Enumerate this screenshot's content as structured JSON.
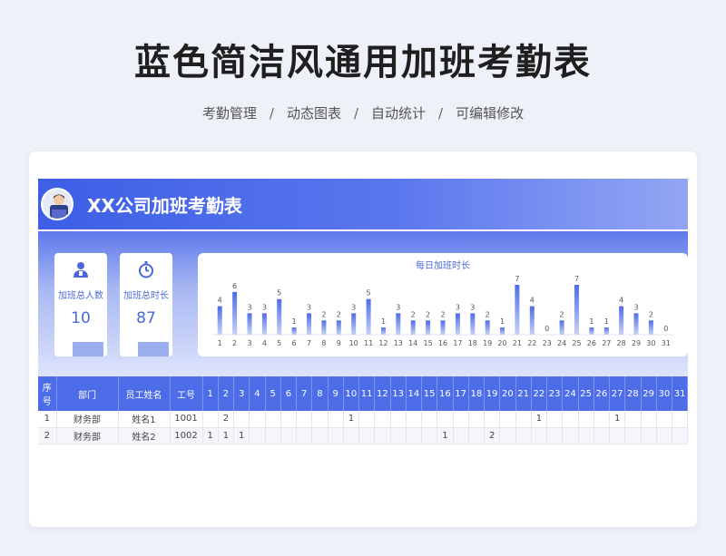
{
  "header": {
    "title": "蓝色简洁风通用加班考勤表",
    "tags": [
      "考勤管理",
      "动态图表",
      "自动统计",
      "可编辑修改"
    ],
    "separators": [
      "/",
      "/",
      "/"
    ]
  },
  "sheet": {
    "banner_title": "XX公司加班考勤表",
    "stats": [
      {
        "label": "加班总人数",
        "value": "10",
        "icon": "employee-icon"
      },
      {
        "label": "加班总时长",
        "value": "87",
        "icon": "stopwatch-icon"
      }
    ],
    "table": {
      "fixed_headers": [
        "序号",
        "部门",
        "员工姓名",
        "工号"
      ],
      "day_headers": [
        "1",
        "2",
        "3",
        "4",
        "5",
        "6",
        "7",
        "8",
        "9",
        "10",
        "11",
        "12",
        "13",
        "14",
        "15",
        "16",
        "17",
        "18",
        "19",
        "20",
        "21",
        "22",
        "23",
        "24",
        "25",
        "26",
        "27",
        "28",
        "29",
        "30",
        "31"
      ],
      "rows": [
        {
          "no": "1",
          "dept": "财务部",
          "name": "姓名1",
          "id": "1001",
          "days": [
            "",
            "2",
            "",
            "",
            "",
            "",
            "",
            "",
            "",
            "1",
            "",
            "",
            "",
            "",
            "",
            "",
            "",
            "",
            "",
            "",
            "",
            "1",
            "",
            "",
            "",
            "",
            "1",
            "",
            "",
            "",
            ""
          ]
        },
        {
          "no": "2",
          "dept": "财务部",
          "name": "姓名2",
          "id": "1002",
          "days": [
            "1",
            "1",
            "1",
            "",
            "",
            "",
            "",
            "",
            "",
            "",
            "",
            "",
            "",
            "",
            "",
            "1",
            "",
            "",
            "2",
            "",
            "",
            "",
            "",
            "",
            "",
            "",
            "",
            "",
            "",
            "",
            ""
          ]
        }
      ]
    }
  },
  "chart_data": {
    "type": "bar",
    "title": "每日加班时长",
    "categories": [
      "1",
      "2",
      "3",
      "4",
      "5",
      "6",
      "7",
      "8",
      "9",
      "10",
      "11",
      "12",
      "13",
      "14",
      "15",
      "16",
      "17",
      "18",
      "19",
      "20",
      "21",
      "22",
      "23",
      "24",
      "25",
      "26",
      "27",
      "28",
      "29",
      "30",
      "31"
    ],
    "values": [
      4,
      6,
      3,
      3,
      5,
      1,
      3,
      2,
      2,
      3,
      5,
      1,
      3,
      2,
      2,
      2,
      3,
      3,
      2,
      1,
      7,
      4,
      0,
      2,
      7,
      1,
      1,
      4,
      3,
      2,
      0
    ],
    "ylim": [
      0,
      7
    ],
    "grid": false,
    "legend": "none",
    "bar_color": "#4d6ce8",
    "bar_color_light": "#c7d2f7"
  }
}
